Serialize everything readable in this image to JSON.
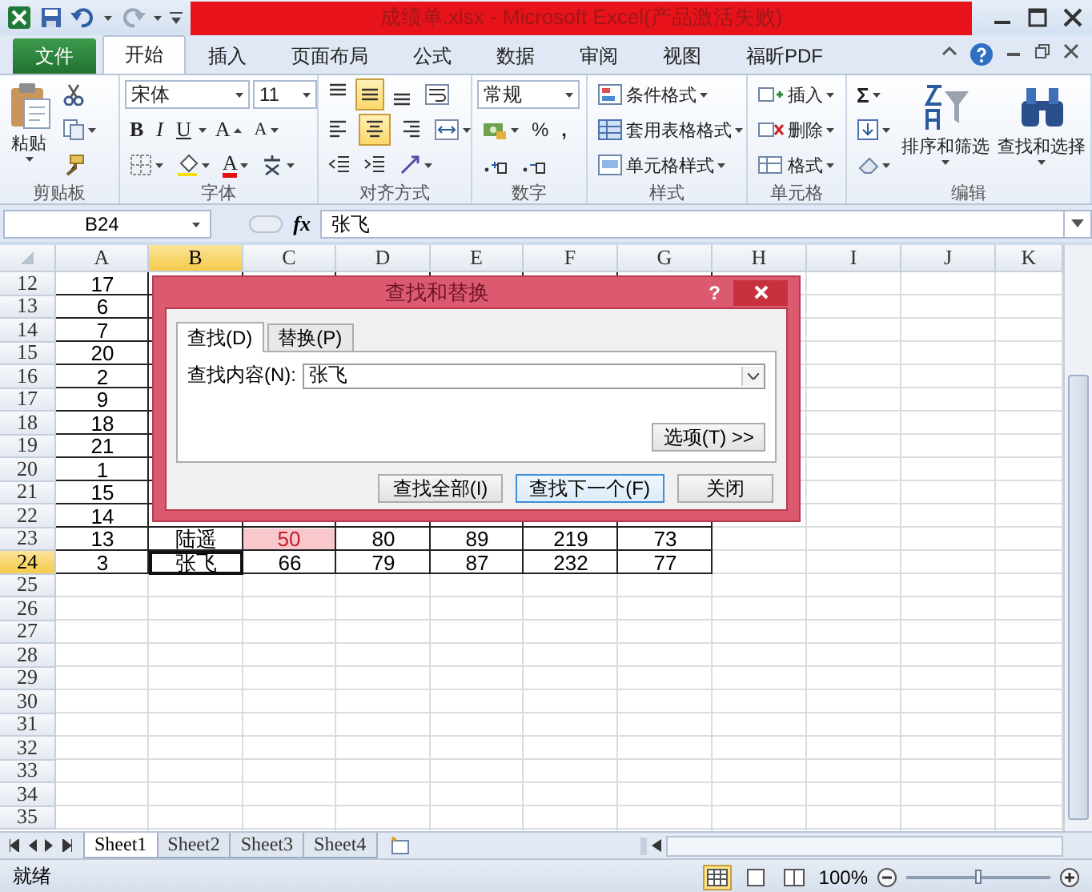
{
  "title_bar": {
    "title": "成绩单.xlsx - Microsoft Excel(产品激活失败)"
  },
  "ribbon": {
    "file_tab": "文件",
    "tabs": [
      {
        "label": "开始",
        "selected": true
      },
      {
        "label": "插入",
        "selected": false
      },
      {
        "label": "页面布局",
        "selected": false
      },
      {
        "label": "公式",
        "selected": false
      },
      {
        "label": "数据",
        "selected": false
      },
      {
        "label": "审阅",
        "selected": false
      },
      {
        "label": "视图",
        "selected": false
      },
      {
        "label": "福昕PDF",
        "selected": false
      }
    ],
    "clipboard": {
      "paste": "粘贴",
      "label": "剪贴板"
    },
    "font": {
      "name": "宋体",
      "size": "11",
      "bold": "B",
      "italic": "I",
      "underline": "U",
      "grow": "A",
      "shrink": "A",
      "font_color": "A",
      "label": "字体"
    },
    "alignment": {
      "label": "对齐方式",
      "buttons": [
        {
          "kind": "top",
          "selected": false
        },
        {
          "kind": "middle",
          "selected": true
        },
        {
          "kind": "bottom",
          "selected": false
        },
        {
          "kind": "left",
          "selected": false
        },
        {
          "kind": "center",
          "selected": true
        },
        {
          "kind": "right",
          "selected": false
        }
      ]
    },
    "number": {
      "format": "常规",
      "percent": "%",
      "comma": ",",
      "label": "数字"
    },
    "styles": {
      "items": [
        "条件格式",
        "套用表格格式",
        "单元格样式"
      ],
      "label": "样式"
    },
    "cells": {
      "items": [
        "插入",
        "删除",
        "格式"
      ],
      "label": "单元格"
    },
    "editing": {
      "sum": "Σ",
      "sort": "排序和筛选",
      "find": "查找和选择",
      "label": "编辑"
    }
  },
  "formula_bar": {
    "name_box": "B24",
    "fx": "fx",
    "value": "张飞"
  },
  "sheet": {
    "columns": [
      {
        "label": "A",
        "selected": false
      },
      {
        "label": "B",
        "selected": true
      },
      {
        "label": "C",
        "selected": false
      },
      {
        "label": "D",
        "selected": false
      },
      {
        "label": "E",
        "selected": false
      },
      {
        "label": "F",
        "selected": false
      },
      {
        "label": "G",
        "selected": false
      },
      {
        "label": "H",
        "selected": false
      },
      {
        "label": "I",
        "selected": false
      },
      {
        "label": "J",
        "selected": false
      },
      {
        "label": "K",
        "selected": false
      }
    ],
    "rows": [
      {
        "number": "12",
        "selected": false,
        "cells": [
          {
            "text": "17",
            "highlighted": false,
            "active": false
          }
        ]
      },
      {
        "number": "13",
        "selected": false,
        "cells": [
          {
            "text": "6",
            "highlighted": false,
            "active": false
          }
        ]
      },
      {
        "number": "14",
        "selected": false,
        "cells": [
          {
            "text": "7",
            "highlighted": false,
            "active": false
          }
        ]
      },
      {
        "number": "15",
        "selected": false,
        "cells": [
          {
            "text": "20",
            "highlighted": false,
            "active": false
          }
        ]
      },
      {
        "number": "16",
        "selected": false,
        "cells": [
          {
            "text": "2",
            "highlighted": false,
            "active": false
          }
        ]
      },
      {
        "number": "17",
        "selected": false,
        "cells": [
          {
            "text": "9",
            "highlighted": false,
            "active": false
          }
        ]
      },
      {
        "number": "18",
        "selected": false,
        "cells": [
          {
            "text": "18",
            "highlighted": false,
            "active": false
          }
        ]
      },
      {
        "number": "19",
        "selected": false,
        "cells": [
          {
            "text": "21",
            "highlighted": false,
            "active": false
          }
        ]
      },
      {
        "number": "20",
        "selected": false,
        "cells": [
          {
            "text": "1",
            "highlighted": false,
            "active": false
          }
        ]
      },
      {
        "number": "21",
        "selected": false,
        "cells": [
          {
            "text": "15",
            "highlighted": false,
            "active": false
          }
        ]
      },
      {
        "number": "22",
        "selected": false,
        "cells": [
          {
            "text": "14",
            "highlighted": false,
            "active": false
          }
        ]
      },
      {
        "number": "23",
        "selected": false,
        "cells": [
          {
            "text": "13",
            "highlighted": false,
            "active": false
          },
          {
            "text": "陆遥",
            "highlighted": false,
            "active": false
          },
          {
            "text": "50",
            "highlighted": true,
            "active": false
          },
          {
            "text": "80",
            "highlighted": false,
            "active": false
          },
          {
            "text": "89",
            "highlighted": false,
            "active": false
          },
          {
            "text": "219",
            "highlighted": false,
            "active": false
          },
          {
            "text": "73",
            "highlighted": false,
            "active": false
          }
        ]
      },
      {
        "number": "24",
        "selected": true,
        "cells": [
          {
            "text": "3",
            "highlighted": false,
            "active": false
          },
          {
            "text": "张飞",
            "highlighted": false,
            "active": true
          },
          {
            "text": "66",
            "highlighted": false,
            "active": false
          },
          {
            "text": "79",
            "highlighted": false,
            "active": false
          },
          {
            "text": "87",
            "highlighted": false,
            "active": false
          },
          {
            "text": "232",
            "highlighted": false,
            "active": false
          },
          {
            "text": "77",
            "highlighted": false,
            "active": false
          }
        ]
      },
      {
        "number": "25",
        "selected": false
      },
      {
        "number": "26",
        "selected": false
      },
      {
        "number": "27",
        "selected": false
      },
      {
        "number": "28",
        "selected": false
      },
      {
        "number": "29",
        "selected": false
      },
      {
        "number": "30",
        "selected": false
      },
      {
        "number": "31",
        "selected": false
      },
      {
        "number": "32",
        "selected": false
      },
      {
        "number": "33",
        "selected": false
      },
      {
        "number": "34",
        "selected": false
      },
      {
        "number": "35",
        "selected": false
      }
    ]
  },
  "dialog": {
    "title": "查找和替换",
    "help": "?",
    "tabs": [
      {
        "label": "查找(D)",
        "selected": true
      },
      {
        "label": "替换(P)",
        "selected": false
      }
    ],
    "find_label": "查找内容(N):",
    "find_value": "张飞",
    "options": "选项(T) >>",
    "buttons": [
      {
        "label": "查找全部(I)",
        "focused": false
      },
      {
        "label": "查找下一个(F)",
        "focused": true
      },
      {
        "label": "关闭",
        "focused": false
      }
    ]
  },
  "sheet_tabs": [
    {
      "label": "Sheet1",
      "selected": true
    },
    {
      "label": "Sheet2",
      "selected": false
    },
    {
      "label": "Sheet3",
      "selected": false
    },
    {
      "label": "Sheet4",
      "selected": false
    }
  ],
  "status_bar": {
    "status": "就绪",
    "zoom": "100%",
    "zoom_slider": {
      "level": 0.5
    }
  }
}
